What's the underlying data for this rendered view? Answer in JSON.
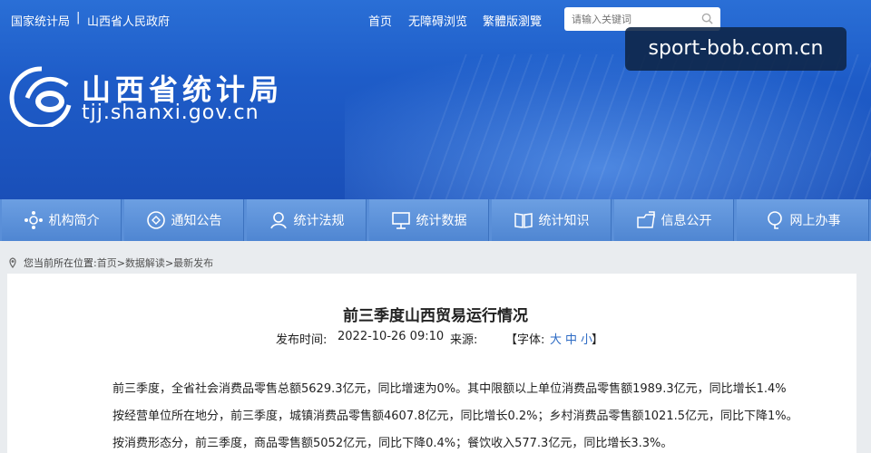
{
  "topbar": {
    "link_nbs": "国家统计局",
    "separator": "|",
    "link_gov": "山西省人民政府",
    "nav": [
      "首页",
      "无障碍浏览",
      "繁體版瀏覽"
    ]
  },
  "search": {
    "placeholder": "请输入关键词"
  },
  "header": {
    "site_name": "山西省统计局",
    "domain": "tjj.shanxi.gov.cn"
  },
  "watermark": "sport-bob.com.cn",
  "colors": {
    "banner": "#1e5cc8",
    "menu": "#5a8fd8",
    "link": "#2d6bc4"
  },
  "menu": [
    {
      "label": "机构简介",
      "icon": "org-icon"
    },
    {
      "label": "通知公告",
      "icon": "notice-icon"
    },
    {
      "label": "统计法规",
      "icon": "law-icon"
    },
    {
      "label": "统计数据",
      "icon": "data-icon"
    },
    {
      "label": "统计知识",
      "icon": "book-icon"
    },
    {
      "label": "信息公开",
      "icon": "open-icon"
    },
    {
      "label": "网上办事",
      "icon": "service-icon"
    }
  ],
  "breadcrumb": {
    "label": "您当前所在位置:",
    "items": [
      "首页",
      "数据解读",
      "最新发布"
    ],
    "sep": ">"
  },
  "article": {
    "title": "前三季度山西贸易运行情况",
    "time_label": "发布时间:",
    "time": "2022-10-26 09:10",
    "source_label": "来源:",
    "font_label": "【字体:",
    "font_sizes": [
      "大",
      "中",
      "小"
    ],
    "font_close": "】",
    "paragraphs": [
      "前三季度，全省社会消费品零售总额5629.3亿元，同比增速为0%。其中限额以上单位消费品零售额1989.3亿元，同比增长1.4%",
      "按经营单位所在地分，前三季度，城镇消费品零售额4607.8亿元，同比增长0.2%；乡村消费品零售额1021.5亿元，同比下降1%。",
      "按消费形态分，前三季度，商品零售额5052亿元，同比下降0.4%；餐饮收入577.3亿元，同比增长3.3%。"
    ]
  }
}
